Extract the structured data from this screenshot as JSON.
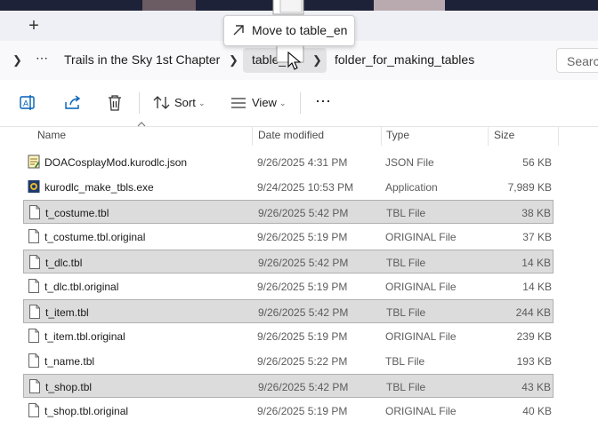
{
  "tabbar": {
    "new_tab": "+"
  },
  "address": {
    "crumbs": [
      "Trails in the Sky 1st Chapter",
      "table_",
      "folder_for_making_tables"
    ],
    "more": "⋯",
    "search_placeholder": "Search"
  },
  "toolbar": {
    "sort_label": "Sort",
    "view_label": "View",
    "more_label": "⋯"
  },
  "columns": {
    "name": "Name",
    "date": "Date modified",
    "type": "Type",
    "size": "Size"
  },
  "files": [
    {
      "name": "DOACosplayMod.kurodlc.json",
      "date": "9/26/2025 4:31 PM",
      "type": "JSON File",
      "size": "56 KB",
      "icon": "json-file-icon",
      "selected": false
    },
    {
      "name": "kurodlc_make_tbls.exe",
      "date": "9/24/2025 10:53 PM",
      "type": "Application",
      "size": "7,989 KB",
      "icon": "exe-file-icon",
      "selected": false
    },
    {
      "name": "t_costume.tbl",
      "date": "9/26/2025 5:42 PM",
      "type": "TBL File",
      "size": "38 KB",
      "icon": "file-icon",
      "selected": true
    },
    {
      "name": "t_costume.tbl.original",
      "date": "9/26/2025 5:19 PM",
      "type": "ORIGINAL File",
      "size": "37 KB",
      "icon": "file-icon",
      "selected": false
    },
    {
      "name": "t_dlc.tbl",
      "date": "9/26/2025 5:42 PM",
      "type": "TBL File",
      "size": "14 KB",
      "icon": "file-icon",
      "selected": true
    },
    {
      "name": "t_dlc.tbl.original",
      "date": "9/26/2025 5:19 PM",
      "type": "ORIGINAL File",
      "size": "14 KB",
      "icon": "file-icon",
      "selected": false
    },
    {
      "name": "t_item.tbl",
      "date": "9/26/2025 5:42 PM",
      "type": "TBL File",
      "size": "244 KB",
      "icon": "file-icon",
      "selected": true
    },
    {
      "name": "t_item.tbl.original",
      "date": "9/26/2025 5:19 PM",
      "type": "ORIGINAL File",
      "size": "239 KB",
      "icon": "file-icon",
      "selected": false
    },
    {
      "name": "t_name.tbl",
      "date": "9/26/2025 5:22 PM",
      "type": "TBL File",
      "size": "193 KB",
      "icon": "file-icon",
      "selected": false
    },
    {
      "name": "t_shop.tbl",
      "date": "9/26/2025 5:42 PM",
      "type": "TBL File",
      "size": "43 KB",
      "icon": "file-icon",
      "selected": true
    },
    {
      "name": "t_shop.tbl.original",
      "date": "9/26/2025 5:19 PM",
      "type": "ORIGINAL File",
      "size": "40 KB",
      "icon": "file-icon",
      "selected": false
    }
  ],
  "tooltip": {
    "label": "Move to table_en"
  },
  "colors": {
    "selection": "#dcdcdc",
    "selection_border": "#b0b0b0",
    "text": "#1a1a1a",
    "muted": "#5c5c5c",
    "accent": "#005fb8"
  }
}
